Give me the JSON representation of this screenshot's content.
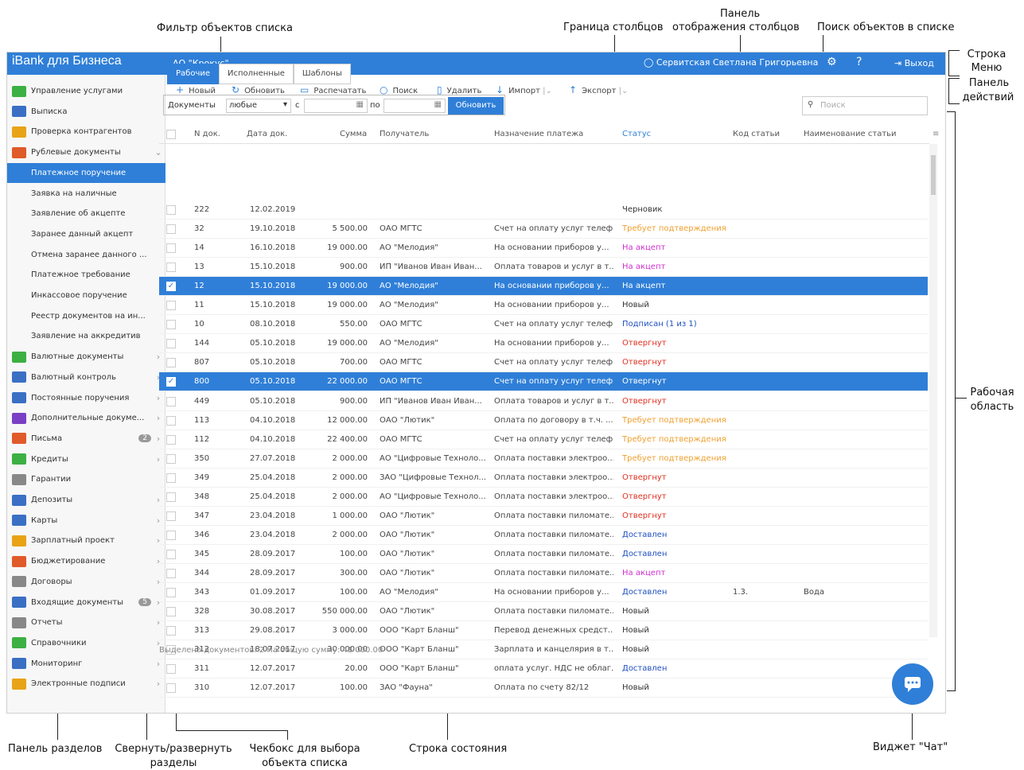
{
  "annotations": {
    "filter": "Фильтр объектов списка",
    "col_border": "Граница столбцов",
    "col_panel_1": "Панель",
    "col_panel_2": "отображения столбцов",
    "search": "Поиск объектов в списке",
    "menu_row_1": "Строка",
    "menu_row_2": "Меню",
    "actions_1": "Панель",
    "actions_2": "действий",
    "work_1": "Рабочая",
    "work_2": "область",
    "sections": "Панель разделов",
    "collapse_1": "Свернуть/развернуть",
    "collapse_2": "разделы",
    "checkbox_1": "Чекбокс для выбора",
    "checkbox_2": "объекта списка",
    "statusrow": "Строка состояния",
    "chat": "Виджет \"Чат\""
  },
  "topbar": {
    "brand": "iBank для Бизнеса",
    "org": "АО \"Крокус\" ⌄",
    "user": "Сервитская Светлана Григорьевна",
    "logout": "Выход"
  },
  "sidebar": {
    "items": [
      {
        "label": "Управление услугами",
        "color": "#3cb043"
      },
      {
        "label": "Выписка",
        "color": "#3a6fc4"
      },
      {
        "label": "Проверка контрагентов",
        "color": "#e8a317"
      },
      {
        "label": "Рублевые документы",
        "color": "#e05a2a"
      },
      {
        "label": "Платежное поручение",
        "color": ""
      },
      {
        "label": "Заявка на наличные",
        "color": ""
      },
      {
        "label": "Заявление об акцепте",
        "color": ""
      },
      {
        "label": "Заранее данный акцепт",
        "color": ""
      },
      {
        "label": "Отмена заранее данного ...",
        "color": ""
      },
      {
        "label": "Платежное требование",
        "color": ""
      },
      {
        "label": "Инкассовое поручение",
        "color": ""
      },
      {
        "label": "Реестр документов на ин...",
        "color": ""
      },
      {
        "label": "Заявление на аккредитив",
        "color": ""
      },
      {
        "label": "Валютные документы",
        "color": "#3cb043"
      },
      {
        "label": "Валютный контроль",
        "color": "#3a6fc4"
      },
      {
        "label": "Постоянные поручения",
        "color": "#3a6fc4"
      },
      {
        "label": "Дополнительные докуме...",
        "color": "#7a3fc4"
      },
      {
        "label": "Письма",
        "color": "#e05a2a"
      },
      {
        "label": "Кредиты",
        "color": "#3cb043"
      },
      {
        "label": "Гарантии",
        "color": "#888888"
      },
      {
        "label": "Депозиты",
        "color": "#3a6fc4"
      },
      {
        "label": "Карты",
        "color": "#3a6fc4"
      },
      {
        "label": "Зарплатный проект",
        "color": "#e8a317"
      },
      {
        "label": "Бюджетирование",
        "color": "#e05a2a"
      },
      {
        "label": "Договоры",
        "color": "#888888"
      },
      {
        "label": "Входящие документы",
        "color": "#3a6fc4"
      },
      {
        "label": "Отчеты",
        "color": "#888888"
      },
      {
        "label": "Справочники",
        "color": "#3cb043"
      },
      {
        "label": "Мониторинг",
        "color": "#3a6fc4"
      },
      {
        "label": "Электронные подписи",
        "color": "#e8a317"
      }
    ],
    "badge_letters": "2",
    "badge_incoming": "5",
    "footer": "iBank для Бизнеса"
  },
  "toolbar": {
    "new": "Новый",
    "refresh": "Обновить",
    "print": "Распечатать",
    "search": "Поиск",
    "delete": "Удалить",
    "import": "Импорт",
    "export": "Экспорт"
  },
  "tabs": [
    "Рабочие",
    "Исполненные",
    "Шаблоны"
  ],
  "filter": {
    "docs_label": "Документы",
    "docs_value": "любые",
    "from_label": "с",
    "to_label": "по",
    "refresh": "Обновить"
  },
  "search_placeholder": "Поиск",
  "columns": [
    "N док.",
    "Дата док.",
    "Сумма",
    "Получатель",
    "Назначение платежа",
    "Статус",
    "Код статьи",
    "Наименование статьи"
  ],
  "status_colors": {
    "Черновик": "#333333",
    "Требует подтверждения": "#f0a030",
    "На акцепт": "#d030d0",
    "Новый": "#333333",
    "Подписан (1 из 1)": "#2050c0",
    "Отвергнут": "#e03020",
    "Доставлен": "#2050c0"
  },
  "rows": [
    {
      "num": "222",
      "date": "12.02.2019",
      "sum": "",
      "recipient": "",
      "purpose": "",
      "status": "Черновик",
      "code": "",
      "name": "",
      "selected": false
    },
    {
      "num": "32",
      "date": "19.10.2018",
      "sum": "5 500.00",
      "recipient": "ОАО МГТС",
      "purpose": "Счет на оплату услуг телеф...",
      "status": "Требует подтверждения",
      "code": "",
      "name": "",
      "selected": false
    },
    {
      "num": "14",
      "date": "16.10.2018",
      "sum": "19 000.00",
      "recipient": "АО \"Мелодия\"",
      "purpose": "На основании приборов у...",
      "status": "На акцепт",
      "code": "",
      "name": "",
      "selected": false
    },
    {
      "num": "13",
      "date": "15.10.2018",
      "sum": "900.00",
      "recipient": "ИП \"Иванов Иван Иван...",
      "purpose": "Оплата товаров и услуг в т...",
      "status": "На акцепт",
      "code": "",
      "name": "",
      "selected": false
    },
    {
      "num": "12",
      "date": "15.10.2018",
      "sum": "19 000.00",
      "recipient": "АО \"Мелодия\"",
      "purpose": "На основании приборов у...",
      "status": "На акцепт",
      "code": "",
      "name": "",
      "selected": true
    },
    {
      "num": "11",
      "date": "15.10.2018",
      "sum": "19 000.00",
      "recipient": "АО \"Мелодия\"",
      "purpose": "На основании приборов у...",
      "status": "Новый",
      "code": "",
      "name": "",
      "selected": false
    },
    {
      "num": "10",
      "date": "08.10.2018",
      "sum": "550.00",
      "recipient": "ОАО МГТС",
      "purpose": "Счет на оплату услуг телеф...",
      "status": "Подписан (1 из 1)",
      "code": "",
      "name": "",
      "selected": false
    },
    {
      "num": "144",
      "date": "05.10.2018",
      "sum": "19 000.00",
      "recipient": "АО \"Мелодия\"",
      "purpose": "На основании приборов у...",
      "status": "Отвергнут",
      "code": "",
      "name": "",
      "selected": false
    },
    {
      "num": "807",
      "date": "05.10.2018",
      "sum": "700.00",
      "recipient": "ОАО МГТС",
      "purpose": "Счет на оплату услуг телеф...",
      "status": "Отвергнут",
      "code": "",
      "name": "",
      "selected": false
    },
    {
      "num": "800",
      "date": "05.10.2018",
      "sum": "22 000.00",
      "recipient": "ОАО МГТС",
      "purpose": "Счет на оплату услуг телеф...",
      "status": "Отвергнут",
      "code": "",
      "name": "",
      "selected": true
    },
    {
      "num": "449",
      "date": "05.10.2018",
      "sum": "900.00",
      "recipient": "ИП \"Иванов Иван Иван...",
      "purpose": "Оплата товаров и услуг в т...",
      "status": "Отвергнут",
      "code": "",
      "name": "",
      "selected": false
    },
    {
      "num": "113",
      "date": "04.10.2018",
      "sum": "12 000.00",
      "recipient": "ОАО \"Лютик\"",
      "purpose": "Оплата по договору в т.ч. ...",
      "status": "Требует подтверждения",
      "code": "",
      "name": "",
      "selected": false
    },
    {
      "num": "112",
      "date": "04.10.2018",
      "sum": "22 400.00",
      "recipient": "ОАО МГТС",
      "purpose": "Счет на оплату услуг телеф...",
      "status": "Требует подтверждения",
      "code": "",
      "name": "",
      "selected": false
    },
    {
      "num": "350",
      "date": "27.07.2018",
      "sum": "2 000.00",
      "recipient": "АО \"Цифровые Техноло...",
      "purpose": "Оплата поставки электроо...",
      "status": "Требует подтверждения",
      "code": "",
      "name": "",
      "selected": false
    },
    {
      "num": "349",
      "date": "25.04.2018",
      "sum": "2 000.00",
      "recipient": "ЗАО \"Цифровые Технол...",
      "purpose": "Оплата поставки электроо...",
      "status": "Отвергнут",
      "code": "",
      "name": "",
      "selected": false
    },
    {
      "num": "348",
      "date": "25.04.2018",
      "sum": "2 000.00",
      "recipient": "АО \"Цифровые Техноло...",
      "purpose": "Оплата поставки электроо...",
      "status": "Отвергнут",
      "code": "",
      "name": "",
      "selected": false
    },
    {
      "num": "347",
      "date": "23.04.2018",
      "sum": "1 000.00",
      "recipient": "ОАО \"Лютик\"",
      "purpose": "Оплата поставки пиломате...",
      "status": "Отвергнут",
      "code": "",
      "name": "",
      "selected": false
    },
    {
      "num": "346",
      "date": "23.04.2018",
      "sum": "2 000.00",
      "recipient": "ОАО \"Лютик\"",
      "purpose": "Оплата поставки пиломате...",
      "status": "Доставлен",
      "code": "",
      "name": "",
      "selected": false
    },
    {
      "num": "345",
      "date": "28.09.2017",
      "sum": "100.00",
      "recipient": "ОАО \"Лютик\"",
      "purpose": "Оплата поставки пиломате...",
      "status": "Доставлен",
      "code": "",
      "name": "",
      "selected": false
    },
    {
      "num": "344",
      "date": "28.09.2017",
      "sum": "300.00",
      "recipient": "ОАО \"Лютик\"",
      "purpose": "Оплата поставки пиломате...",
      "status": "На акцепт",
      "code": "",
      "name": "",
      "selected": false
    },
    {
      "num": "343",
      "date": "01.09.2017",
      "sum": "100.00",
      "recipient": "АО \"Мелодия\"",
      "purpose": "На основании приборов у...",
      "status": "Доставлен",
      "code": "1.3.",
      "name": "Вода",
      "selected": false
    },
    {
      "num": "328",
      "date": "30.08.2017",
      "sum": "550 000.00",
      "recipient": "ОАО \"Лютик\"",
      "purpose": "Оплата поставки пиломате...",
      "status": "Новый",
      "code": "",
      "name": "",
      "selected": false
    },
    {
      "num": "313",
      "date": "29.08.2017",
      "sum": "3 000.00",
      "recipient": "ООО \"Карт Бланш\"",
      "purpose": "Перевод денежных средст...",
      "status": "Новый",
      "code": "",
      "name": "",
      "selected": false
    },
    {
      "num": "312",
      "date": "18.07.2017",
      "sum": "30 000.00",
      "recipient": "ООО \"Карт Бланш\"",
      "purpose": "Зарплата и канцелярия в т...",
      "status": "Новый",
      "code": "",
      "name": "",
      "selected": false
    },
    {
      "num": "311",
      "date": "12.07.2017",
      "sum": "20.00",
      "recipient": "ООО \"Карт Бланш\"",
      "purpose": "оплата услуг. НДС не облаг...",
      "status": "Доставлен",
      "code": "",
      "name": "",
      "selected": false
    },
    {
      "num": "310",
      "date": "12.07.2017",
      "sum": "100.00",
      "recipient": "ЗАО \"Фауна\"",
      "purpose": "Оплата по счету 82/12",
      "status": "Новый",
      "code": "",
      "name": "",
      "selected": false
    }
  ],
  "statusbar": "Выделено документов: 2 На общую сумму: 41 000.00"
}
